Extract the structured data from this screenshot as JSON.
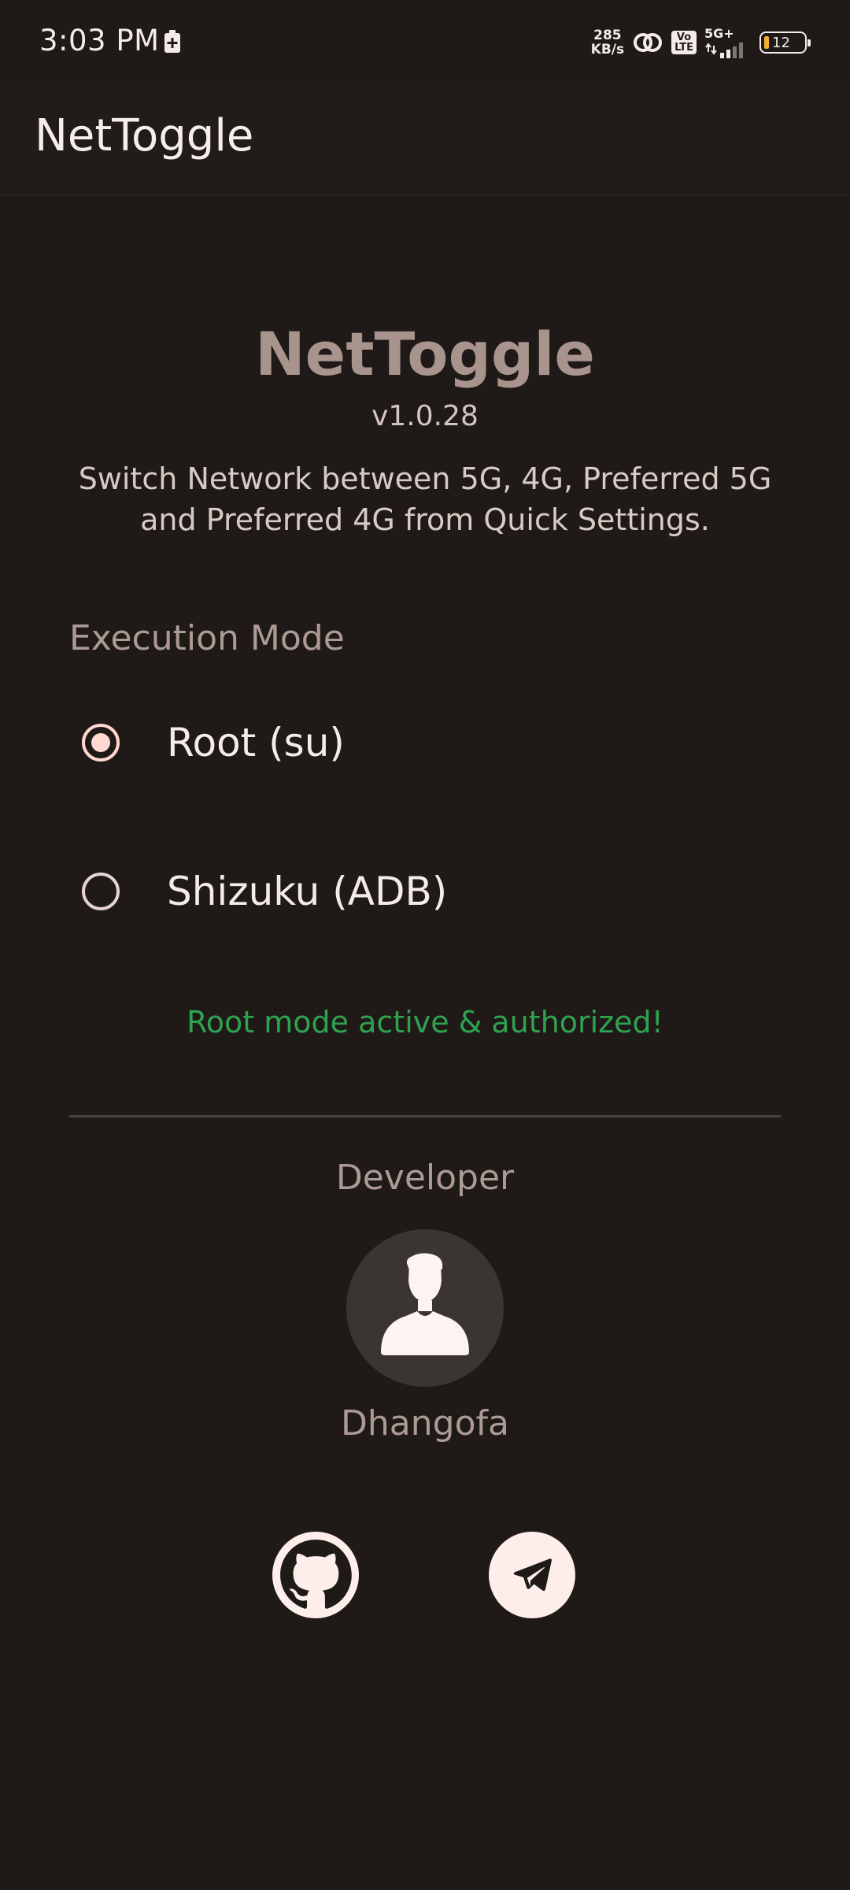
{
  "status_bar": {
    "time": "3:03 PM",
    "speed_value": "285",
    "speed_unit": "KB/s",
    "volte_top": "Vo",
    "volte_bottom": "LTE",
    "network_type": "5G+",
    "battery_level": "12",
    "battery_color": "#f2b02e"
  },
  "app_bar": {
    "title": "NetToggle"
  },
  "header": {
    "app_name": "NetToggle",
    "version": "v1.0.28",
    "description": "Switch Network between 5G, 4G, Preferred 5G and Preferred 4G from Quick Settings."
  },
  "execution_mode": {
    "title": "Execution Mode",
    "options": [
      {
        "label": "Root (su)",
        "selected": true
      },
      {
        "label": "Shizuku (ADB)",
        "selected": false
      }
    ],
    "status_message": "Root mode active & authorized!",
    "status_color": "#2fa24f"
  },
  "developer": {
    "heading": "Developer",
    "name": "Dhangofa",
    "avatar_icon": "person-icon",
    "links": [
      {
        "icon": "github-icon"
      },
      {
        "icon": "telegram-icon"
      }
    ]
  },
  "colors": {
    "background": "#1f1a18",
    "accent": "#ffd9cf",
    "muted_text": "#ad9a93"
  }
}
